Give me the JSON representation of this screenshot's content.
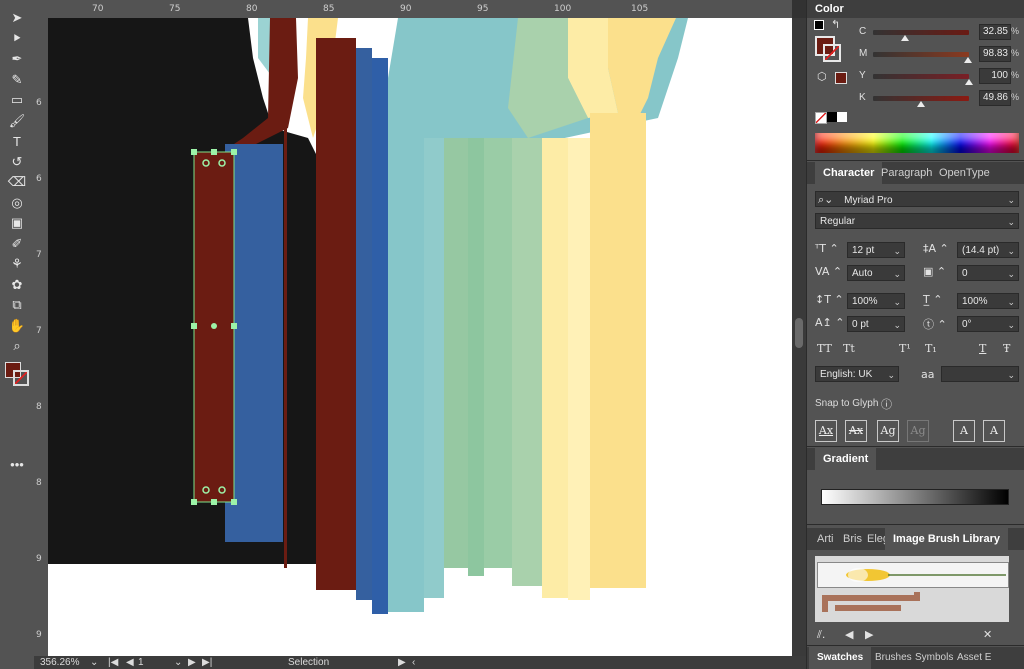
{
  "tools": [
    {
      "name": "selection-tool-icon",
      "glyph": "➤"
    },
    {
      "name": "direct-selection-tool-icon",
      "glyph": "⯈"
    },
    {
      "name": "pen-tool-icon",
      "glyph": "✒"
    },
    {
      "name": "curvature-tool-icon",
      "glyph": "✎"
    },
    {
      "name": "rectangle-tool-icon",
      "glyph": "▭"
    },
    {
      "name": "paintbrush-tool-icon",
      "glyph": "🖌"
    },
    {
      "name": "type-tool-icon",
      "glyph": "T"
    },
    {
      "name": "rotate-tool-icon",
      "glyph": "↺"
    },
    {
      "name": "eraser-tool-icon",
      "glyph": "⌫"
    },
    {
      "name": "shape-builder-tool-icon",
      "glyph": "◎"
    },
    {
      "name": "gradient-tool-icon",
      "glyph": "▣"
    },
    {
      "name": "eyedropper-tool-icon",
      "glyph": "✐"
    },
    {
      "name": "blend-tool-icon",
      "glyph": "⚘"
    },
    {
      "name": "symbol-sprayer-tool-icon",
      "glyph": "✿"
    },
    {
      "name": "artboard-tool-icon",
      "glyph": "⧉"
    },
    {
      "name": "hand-tool-icon",
      "glyph": "✋"
    },
    {
      "name": "zoom-tool-icon",
      "glyph": "⌕"
    }
  ],
  "ruler": {
    "top": [
      "70",
      "75",
      "80",
      "85",
      "90",
      "95",
      "100",
      "105"
    ],
    "left": [
      "6",
      "6",
      "7",
      "7",
      "8",
      "8",
      "9",
      "9"
    ]
  },
  "status": {
    "zoom": "356.26%",
    "artboard": "1",
    "tool": "Selection"
  },
  "color_panel": {
    "title": "Color",
    "sliders": [
      {
        "label": "C",
        "value": "32.85",
        "pct": "%",
        "track": "#6a1a13",
        "thumb": 0.33
      },
      {
        "label": "M",
        "value": "98.83",
        "pct": "%",
        "track": "#8a3a20",
        "thumb": 0.99
      },
      {
        "label": "Y",
        "value": "100",
        "pct": "%",
        "track": "#7a1f25",
        "thumb": 1.0
      },
      {
        "label": "K",
        "value": "49.86",
        "pct": "%",
        "track": "#8b1a12",
        "thumb": 0.5
      }
    ],
    "fill": "#6b1c12"
  },
  "character_panel": {
    "tabs": [
      "Character",
      "Paragraph",
      "OpenType"
    ],
    "font_family": "Myriad Pro",
    "font_style": "Regular",
    "font_size": "12 pt",
    "leading": "(14.4 pt)",
    "kerning": "Auto",
    "tracking": "0",
    "vscale": "100%",
    "hscale": "100%",
    "baseline": "0 pt",
    "rotation": "0°",
    "language": "English: UK",
    "aa_label": "aa",
    "snap_label": "Snap to Glyph",
    "caps": [
      "TT",
      "Tt",
      "T¹",
      "T₁",
      "T",
      "Ŧ"
    ],
    "snap_glyphs": [
      "Ax",
      "Ax",
      "Ag",
      "Ag",
      "A",
      "A"
    ]
  },
  "gradient_panel": {
    "title": "Gradient"
  },
  "brush_panel": {
    "tabs": [
      "Arti",
      "Bris",
      "Eleg",
      "Image Brush Library"
    ]
  },
  "bottom_tabs": [
    "Swatches",
    "Brushes",
    "Symbols",
    "Asset E"
  ],
  "art_colors": {
    "black": "#161616",
    "maroon": "#6b1c12",
    "blue": "#35609f",
    "teal": "#86c6c9",
    "green": "#96c8a2",
    "sage": "#a9d1ac",
    "cream": "#fdeca6",
    "yellow": "#fbe08c"
  }
}
